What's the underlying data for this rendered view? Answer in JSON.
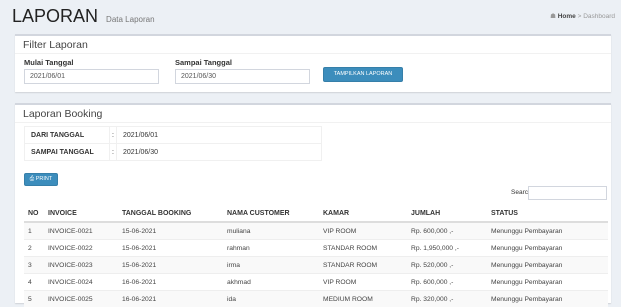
{
  "header": {
    "title": "LAPORAN",
    "subtitle": "Data Laporan"
  },
  "breadcrumb": {
    "home": "Home",
    "separator": ">",
    "current": "Dashboard"
  },
  "filter": {
    "title": "Filter Laporan",
    "start_label": "Mulai Tanggal",
    "start_value": "2021/06/01",
    "end_label": "Sampai Tanggal",
    "end_value": "2021/06/30",
    "submit_label": "TAMPILKAN LAPORAN"
  },
  "report": {
    "title": "Laporan Booking",
    "info": [
      {
        "key": "DARI TANGGAL",
        "sep": ":",
        "value": "2021/06/01"
      },
      {
        "key": "SAMPAI TANGGAL",
        "sep": ":",
        "value": "2021/06/30"
      }
    ],
    "print_label": "PRINT",
    "search_label": "Search:",
    "columns": [
      "NO",
      "INVOICE",
      "TANGGAL BOOKING",
      "NAMA CUSTOMER",
      "KAMAR",
      "JUMLAH",
      "STATUS"
    ],
    "rows": [
      [
        "1",
        "INVOICE-0021",
        "15-06-2021",
        "muliana",
        "VIP ROOM",
        "Rp. 600,000 ,-",
        "Menunggu Pembayaran"
      ],
      [
        "2",
        "INVOICE-0022",
        "15-06-2021",
        "rahman",
        "STANDAR ROOM",
        "Rp. 1,950,000 ,-",
        "Menunggu Pembayaran"
      ],
      [
        "3",
        "INVOICE-0023",
        "15-06-2021",
        "irma",
        "STANDAR ROOM",
        "Rp. 520,000 ,-",
        "Menunggu Pembayaran"
      ],
      [
        "4",
        "INVOICE-0024",
        "16-06-2021",
        "akhmad",
        "VIP ROOM",
        "Rp. 600,000 ,-",
        "Menunggu Pembayaran"
      ],
      [
        "5",
        "INVOICE-0025",
        "16-06-2021",
        "ida",
        "MEDIUM ROOM",
        "Rp. 320,000 ,-",
        "Menunggu Pembayaran"
      ]
    ]
  },
  "colors": {
    "primary": "#3c8dbc",
    "background": "#ecf0f5",
    "border": "#d2d6de"
  }
}
